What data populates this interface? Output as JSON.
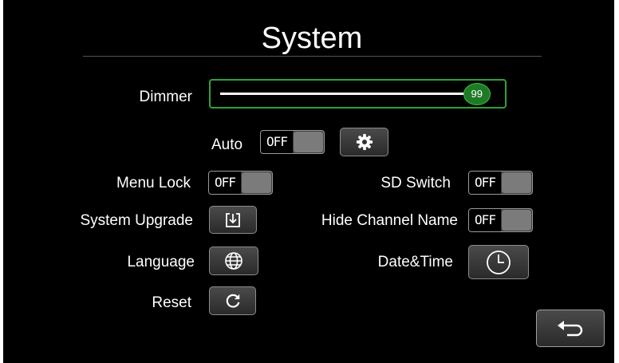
{
  "screen": {
    "title": "System"
  },
  "dimmer": {
    "label": "Dimmer",
    "value": 99,
    "value_label": "99",
    "min": 0,
    "max": 100,
    "accent_color": "#2fa237"
  },
  "auto": {
    "label": "Auto",
    "toggle_text": "OFF",
    "settings_icon": "gear-icon"
  },
  "menu_lock": {
    "label": "Menu Lock",
    "toggle_text": "OFF"
  },
  "sd_switch": {
    "label": "SD Switch",
    "toggle_text": "OFF"
  },
  "system_upgrade": {
    "label": "System Upgrade",
    "icon": "download-icon"
  },
  "hide_channel_name": {
    "label": "Hide Channel Name",
    "toggle_text": "OFF"
  },
  "language": {
    "label": "Language",
    "icon": "globe-icon"
  },
  "date_time": {
    "label": "Date&Time",
    "icon": "clock-icon"
  },
  "reset": {
    "label": "Reset",
    "icon": "refresh-icon"
  },
  "back": {
    "icon": "back-arrow-icon"
  }
}
